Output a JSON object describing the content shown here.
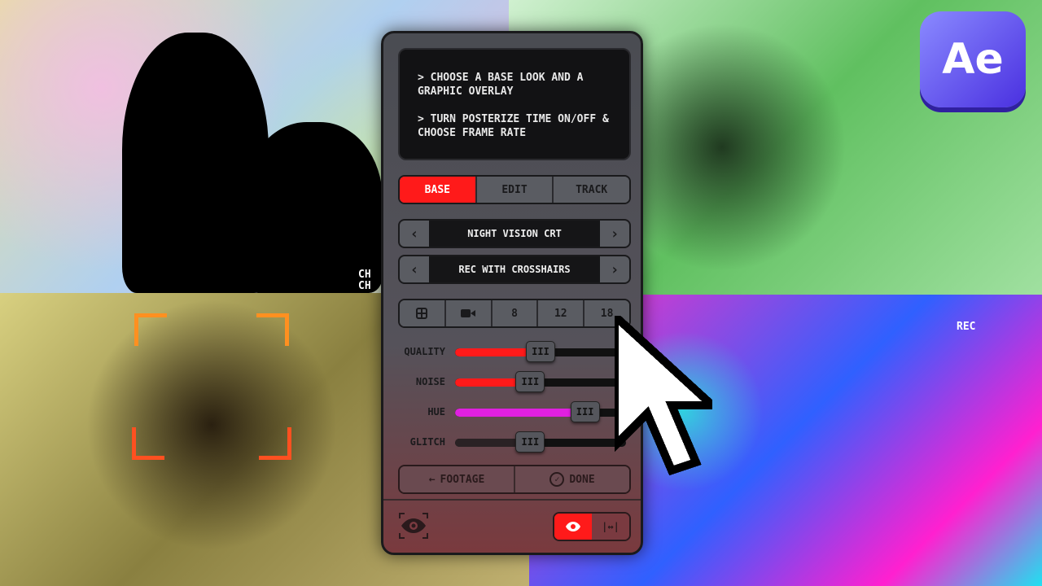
{
  "overlays": {
    "ch_label_1": "CH",
    "ch_label_2": "CH",
    "rec_label": "REC"
  },
  "logo": {
    "text": "Ae",
    "color": "#5a40f0"
  },
  "panel": {
    "instructions": [
      "> CHOOSE A BASE LOOK AND A GRAPHIC OVERLAY",
      "> TURN POSTERIZE TIME ON/OFF & CHOOSE FRAME RATE"
    ],
    "tabs": [
      {
        "label": "BASE",
        "active": true
      },
      {
        "label": "EDIT",
        "active": false
      },
      {
        "label": "TRACK",
        "active": false
      }
    ],
    "base_look": {
      "prev": "‹",
      "value": "NIGHT VISION CRT",
      "next": "›"
    },
    "overlay": {
      "prev": "‹",
      "value": "REC WITH CROSSHAIRS",
      "next": "›"
    },
    "frame_rate": {
      "icons": [
        "grid-icon",
        "video-camera-icon"
      ],
      "options": [
        "8",
        "12",
        "18"
      ]
    },
    "sliders": [
      {
        "label": "QUALITY",
        "value": 50,
        "color": "#ff1a1a"
      },
      {
        "label": "NOISE",
        "value": 44,
        "color": "#ff1a1a"
      },
      {
        "label": "HUE",
        "value": 76,
        "color": "#e020e0"
      },
      {
        "label": "GLITCH",
        "value": 44,
        "color": "#2a2224"
      }
    ],
    "handle_glyph": "III",
    "actions": {
      "footage": "FOOTAGE",
      "footage_icon": "←",
      "done": "DONE",
      "done_icon": "✓"
    },
    "toggle": {
      "eye_on": true,
      "fit_glyph": "|↔|"
    }
  },
  "colors": {
    "accent": "#ff1a1a",
    "panel": "#4a4c52"
  }
}
